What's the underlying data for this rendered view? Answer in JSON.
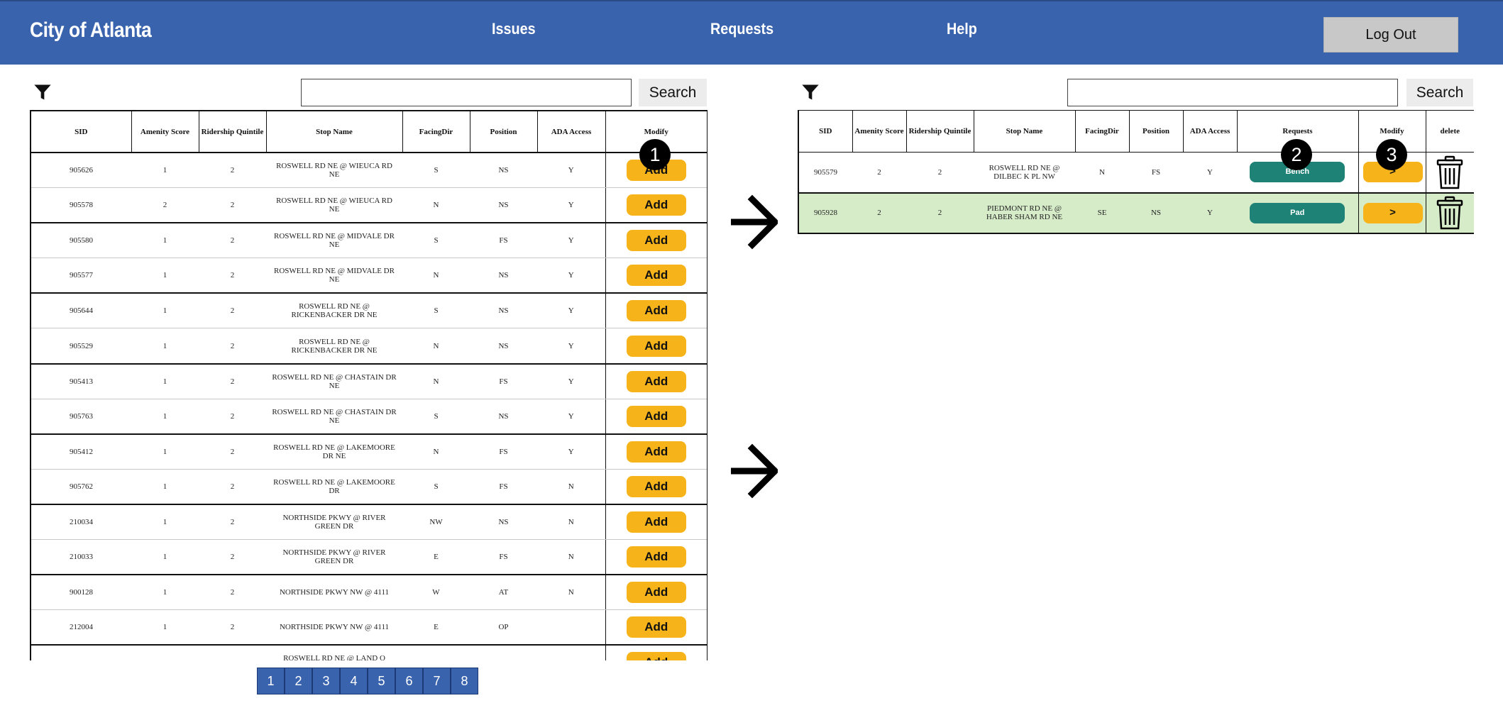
{
  "header": {
    "brand": "City of Atlanta",
    "nav": [
      "Issues",
      "Requests",
      "Help"
    ],
    "logout_label": "Log Out",
    "color": "#3a63ae"
  },
  "left_panel": {
    "search_placeholder": "",
    "search_label": "Search",
    "columns": [
      "SID",
      "Amenity Score",
      "Ridership Quintile",
      "Stop Name",
      "FacingDir",
      "Position",
      "ADA Access",
      "Modify"
    ],
    "add_label": "Add",
    "rows": [
      {
        "sid": "905626",
        "amenity": "1",
        "ridership": "2",
        "stop": "ROSWELL RD NE @ WIEUCA RD NE",
        "facing": "S",
        "position": "NS",
        "ada": "Y"
      },
      {
        "sid": "905578",
        "amenity": "2",
        "ridership": "2",
        "stop": "ROSWELL RD NE @ WIEUCA RD NE",
        "facing": "N",
        "position": "NS",
        "ada": "Y"
      },
      {
        "sid": "905580",
        "amenity": "1",
        "ridership": "2",
        "stop": "ROSWELL RD NE @ MIDVALE DR NE",
        "facing": "S",
        "position": "FS",
        "ada": "Y"
      },
      {
        "sid": "905577",
        "amenity": "1",
        "ridership": "2",
        "stop": "ROSWELL RD NE @ MIDVALE DR NE",
        "facing": "N",
        "position": "NS",
        "ada": "Y"
      },
      {
        "sid": "905644",
        "amenity": "1",
        "ridership": "2",
        "stop": "ROSWELL RD NE @ RICKENBACKER DR NE",
        "facing": "S",
        "position": "NS",
        "ada": "Y"
      },
      {
        "sid": "905529",
        "amenity": "1",
        "ridership": "2",
        "stop": "ROSWELL RD NE @ RICKENBACKER DR NE",
        "facing": "N",
        "position": "NS",
        "ada": "Y"
      },
      {
        "sid": "905413",
        "amenity": "1",
        "ridership": "2",
        "stop": "ROSWELL RD NE @ CHASTAIN DR NE",
        "facing": "N",
        "position": "FS",
        "ada": "Y"
      },
      {
        "sid": "905763",
        "amenity": "1",
        "ridership": "2",
        "stop": "ROSWELL RD NE @ CHASTAIN DR NE",
        "facing": "S",
        "position": "NS",
        "ada": "Y"
      },
      {
        "sid": "905412",
        "amenity": "1",
        "ridership": "2",
        "stop": "ROSWELL RD NE @ LAKEMOORE DR NE",
        "facing": "N",
        "position": "FS",
        "ada": "Y"
      },
      {
        "sid": "905762",
        "amenity": "1",
        "ridership": "2",
        "stop": "ROSWELL RD NE @ LAKEMOORE DR",
        "facing": "S",
        "position": "FS",
        "ada": "N"
      },
      {
        "sid": "210034",
        "amenity": "1",
        "ridership": "2",
        "stop": "NORTHSIDE PKWY @ RIVER GREEN DR",
        "facing": "NW",
        "position": "NS",
        "ada": "N"
      },
      {
        "sid": "210033",
        "amenity": "1",
        "ridership": "2",
        "stop": "NORTHSIDE PKWY @ RIVER GREEN DR",
        "facing": "E",
        "position": "FS",
        "ada": "N"
      },
      {
        "sid": "900128",
        "amenity": "1",
        "ridership": "2",
        "stop": "NORTHSIDE PKWY NW @ 4111",
        "facing": "W",
        "position": "AT",
        "ada": "N"
      },
      {
        "sid": "212004",
        "amenity": "1",
        "ridership": "2",
        "stop": "NORTHSIDE PKWY NW @ 4111",
        "facing": "E",
        "position": "OP",
        "ada": ""
      },
      {
        "sid": "",
        "amenity": "",
        "ridership": "",
        "stop": "ROSWELL RD NE @ LAND O LAKES D",
        "facing": "",
        "position": "",
        "ada": ""
      }
    ],
    "pages": [
      "1",
      "2",
      "3",
      "4",
      "5",
      "6",
      "7",
      "8"
    ]
  },
  "right_panel": {
    "search_placeholder": "",
    "search_label": "Search",
    "columns": [
      "SID",
      "Amenity Score",
      "Ridership Quintile",
      "Stop Name",
      "FacingDir",
      "Position",
      "ADA Access",
      "Requests",
      "Modify",
      "delete"
    ],
    "go_label": ">",
    "rows": [
      {
        "sid": "905579",
        "amenity": "2",
        "ridership": "2",
        "stop": "ROSWELL RD NE @ DILBEC K PL NW",
        "facing": "N",
        "position": "FS",
        "ada": "Y",
        "request": "Bench",
        "highlight": false
      },
      {
        "sid": "905928",
        "amenity": "2",
        "ridership": "2",
        "stop": "PIEDMONT RD NE @ HABER SHAM RD NE",
        "facing": "SE",
        "position": "NS",
        "ada": "Y",
        "request": "Pad",
        "highlight": true
      }
    ]
  },
  "annotations": [
    "1",
    "2",
    "3"
  ],
  "colors": {
    "accent_yellow": "#f6b41a",
    "request_teal": "#1f8277",
    "highlight_row": "#d6ecc9",
    "pager_blue": "#3a63ae"
  },
  "icons": {
    "filter": "filter-icon",
    "trash": "trash-icon",
    "arrow": "arrow-right-icon"
  }
}
